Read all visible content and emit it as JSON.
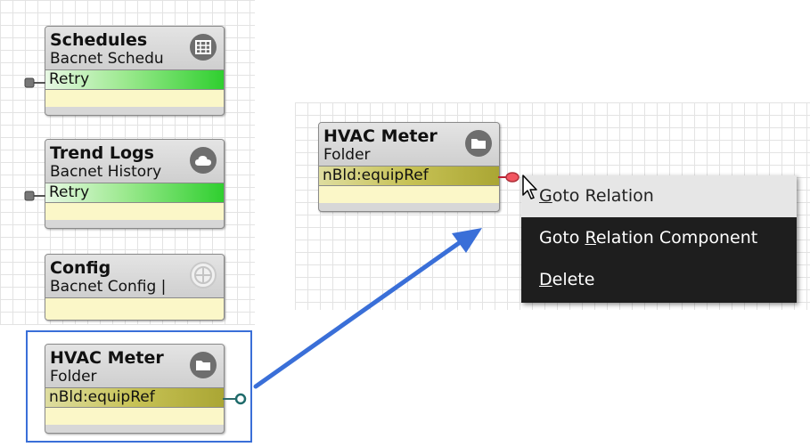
{
  "cards": {
    "schedules": {
      "title": "Schedules",
      "subtitle": "Bacnet Schedu",
      "slot": "Retry",
      "icon": "calendar-grid-icon"
    },
    "trend_logs": {
      "title": "Trend Logs",
      "subtitle": "Bacnet History",
      "slot": "Retry",
      "icon": "cloud-icon"
    },
    "config": {
      "title": "Config",
      "subtitle": "Bacnet Config |",
      "icon": "network-globe-icon"
    },
    "hvac_left": {
      "title": "HVAC Meter",
      "subtitle": "Folder",
      "slot": "nBld:equipRef",
      "icon": "folder-icon"
    },
    "hvac_right": {
      "title": "HVAC Meter",
      "subtitle": "Folder",
      "slot": "nBld:equipRef",
      "icon": "folder-icon"
    }
  },
  "context_menu": {
    "items": [
      {
        "accel": "G",
        "rest": "oto Relation"
      },
      {
        "pre": "Goto ",
        "accel": "R",
        "rest": "elation Component"
      },
      {
        "accel": "D",
        "rest": "elete"
      }
    ],
    "hovered_index": 0
  },
  "colors": {
    "selection_blue": "#3a6fd8",
    "arrow_blue": "#3a6fd8",
    "slot_green": "#2fcf2f",
    "slot_olive": "#aaa634",
    "menu_bg": "#1e1e1e"
  }
}
